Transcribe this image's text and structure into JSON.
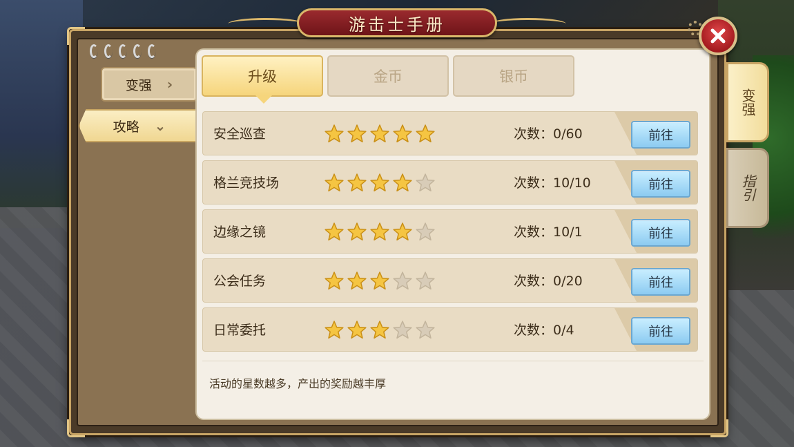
{
  "window": {
    "title": "游击士手册"
  },
  "sidebar": {
    "items": [
      {
        "label": "变强",
        "state": "inactive",
        "icon": "chevron-right-icon"
      },
      {
        "label": "攻略",
        "state": "active",
        "icon": "chevron-down-icon"
      }
    ]
  },
  "tabs": [
    {
      "label": "升级",
      "active": true
    },
    {
      "label": "金币",
      "active": false
    },
    {
      "label": "银币",
      "active": false
    }
  ],
  "activities": [
    {
      "name": "安全巡查",
      "stars": 5,
      "max_stars": 5,
      "count": "次数：0/60",
      "button": "前往"
    },
    {
      "name": "格兰竞技场",
      "stars": 4,
      "max_stars": 5,
      "count": "次数：10/10",
      "button": "前往"
    },
    {
      "name": "边缘之镜",
      "stars": 4,
      "max_stars": 5,
      "count": "次数：10/1",
      "button": "前往"
    },
    {
      "name": "公会任务",
      "stars": 3,
      "max_stars": 5,
      "count": "次数：0/20",
      "button": "前往"
    },
    {
      "name": "日常委托",
      "stars": 3,
      "max_stars": 5,
      "count": "次数：0/4",
      "button": "前往"
    }
  ],
  "footer": {
    "hint": "活动的星数越多，产出的奖励越丰厚"
  },
  "side_tabs": [
    {
      "label": "变强",
      "active": true
    },
    {
      "label": "指引",
      "active": false
    }
  ],
  "colors": {
    "star_filled": "#f5c542",
    "star_empty": "#d8ccb8",
    "accent_red": "#a41b1f",
    "accent_gold": "#d9b66a",
    "button_blue": "#8ccbf1"
  },
  "icons": {
    "close": "close-icon",
    "star": "star-icon"
  }
}
